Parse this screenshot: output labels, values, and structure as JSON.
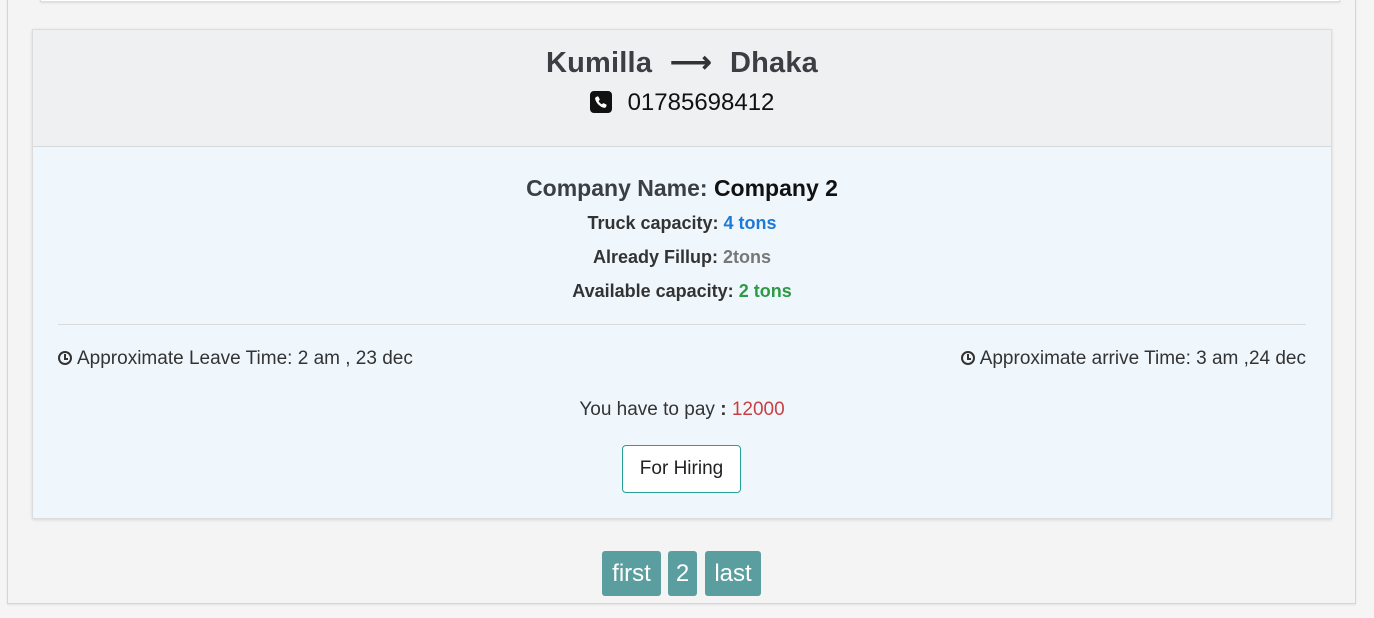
{
  "route": {
    "from": "Kumilla",
    "arrow": "⟶",
    "to": "Dhaka"
  },
  "contact": {
    "icon": "phone-square-icon",
    "phone": "01785698412"
  },
  "company": {
    "label": "Company Name:",
    "name": "Company 2"
  },
  "capacity": {
    "truck_label": "Truck capacity:",
    "truck_value": "4 tons",
    "filled_label": "Already Fillup:",
    "filled_value": "2tons",
    "available_label": "Available capacity:",
    "available_value": "2 tons"
  },
  "times": {
    "icon": "clock-icon",
    "leave": "Approximate Leave Time: 2 am , 23 dec",
    "arrive": "Approximate arrive Time: 3 am ,24 dec"
  },
  "payment": {
    "label": "You have to pay",
    "separator": ":",
    "amount": "12000"
  },
  "actions": {
    "hire_label": "For Hiring"
  },
  "pagination": {
    "first": "first",
    "current": "2",
    "last": "last"
  },
  "colors": {
    "accent_teal": "#5b9ea0",
    "capacity_blue": "#1e7ad6",
    "available_green": "#2e9a46",
    "amount_red": "#c94043",
    "button_border": "#27a198"
  }
}
